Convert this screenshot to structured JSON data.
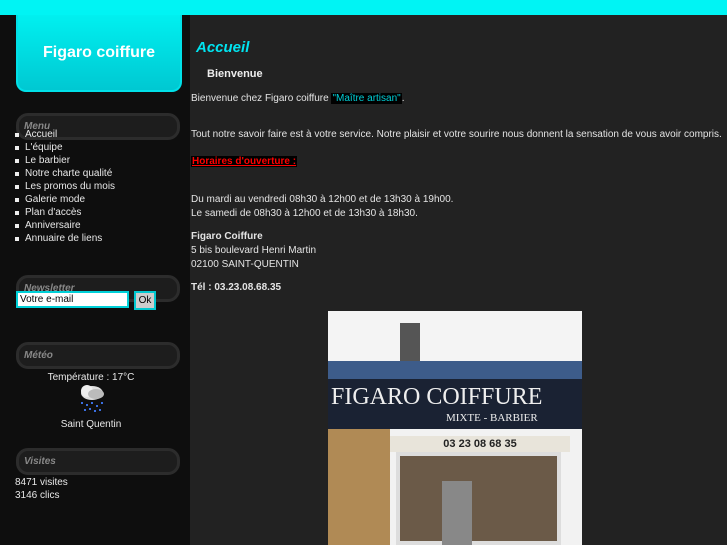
{
  "site_title": "Figaro coiffure",
  "menu": {
    "title": "Menu",
    "items": [
      "Accueil",
      "L'équipe",
      "Le barbier",
      "Notre charte qualité",
      "Les promos du mois",
      "Galerie mode",
      "Plan d'accès",
      "Anniversaire",
      "Annuaire de liens"
    ]
  },
  "newsletter": {
    "title": "Newsletter",
    "email_value": "Votre e-mail",
    "ok_label": "Ok"
  },
  "meteo": {
    "title": "Météo",
    "temperature": "Température : 17°C",
    "icon": "rain-cloud-icon",
    "city": "Saint Quentin"
  },
  "visites": {
    "title": "Visites",
    "visits": "8471 visites",
    "clicks": "3146 clics"
  },
  "main": {
    "page_title": "Accueil",
    "heading": "Bienvenue",
    "welcome_text": "Bienvenue chez Figaro coiffure ",
    "welcome_highlight": "\"Maître artisan\"",
    "welcome_end": ".",
    "service_text": "Tout notre savoir faire est à votre service. Notre plaisir et votre sourire nous donnent la sensation de vous avoir compris.",
    "hours_title": "Horaires d'ouverture :",
    "hours": [
      "Du mardi au vendredi 08h30 à 12h00 et de 13h30 à 19h00.",
      "Le samedi de 08h30 à 12h00 et de 13h30 à 18h30."
    ],
    "address": {
      "name": "Figaro Coiffure",
      "street": "5 bis boulevard Henri Martin",
      "city": "02100 SAINT-QUENTIN"
    },
    "phone": "Tél : 03.23.08.68.35",
    "photo": {
      "sign": "FIGARO COIFFURE",
      "subsign": "MIXTE - BARBIER",
      "phone": "03 23 08 68 35"
    }
  },
  "colors": {
    "accent": "#00f4f4",
    "background": "#222222",
    "sidebar": "#0e0e0e",
    "hours": "#ff0000"
  }
}
